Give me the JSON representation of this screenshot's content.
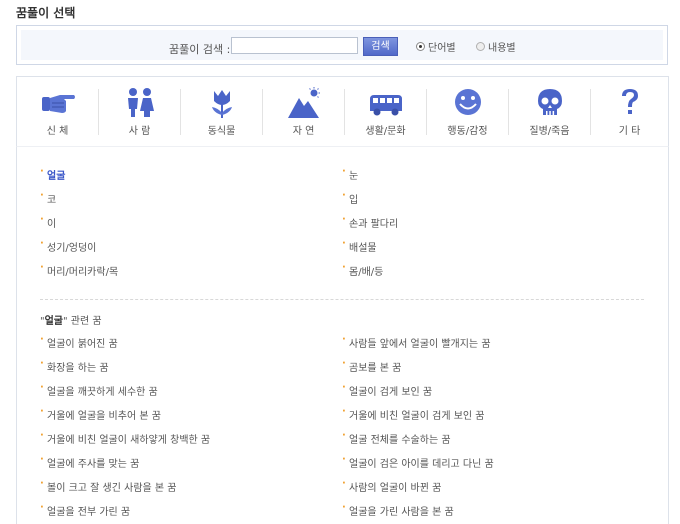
{
  "page_title": "꿈풀이 선택",
  "search": {
    "label": "꿈풀이 검색 :",
    "value": "",
    "placeholder": "",
    "button": "검색",
    "options": [
      {
        "label": "단어별",
        "selected": true
      },
      {
        "label": "내용별",
        "selected": false
      }
    ]
  },
  "categories": [
    {
      "label": "신 체",
      "icon": "pointing-hand-icon"
    },
    {
      "label": "사 람",
      "icon": "people-icon"
    },
    {
      "label": "동식물",
      "icon": "tulip-icon"
    },
    {
      "label": "자 연",
      "icon": "mountain-sun-icon"
    },
    {
      "label": "생활/문화",
      "icon": "bus-icon"
    },
    {
      "label": "행동/감정",
      "icon": "smiley-icon"
    },
    {
      "label": "질병/죽음",
      "icon": "skull-icon"
    },
    {
      "label": "기 타",
      "icon": "question-icon"
    }
  ],
  "body_parts": [
    "얼굴",
    "눈",
    "코",
    "입",
    "이",
    "손과 팔다리",
    "성기/엉덩이",
    "배설물",
    "머리/머리카락/목",
    "몸/배/등"
  ],
  "selected_part": "얼굴",
  "related": {
    "keyword": "얼굴",
    "title_suffix": "관련 꿈",
    "items": [
      "얼굴이 붉어진 꿈",
      "사람들 앞에서 얼굴이 빨개지는 꿈",
      "화장을 하는 꿈",
      "곰보를 본 꿈",
      "얼굴을 깨끗하게 세수한 꿈",
      "얼굴이 검게 보인 꿈",
      "거울에 얼굴을 비추어 본 꿈",
      "거울에 비친 얼굴이 검게 보인 꿈",
      "거울에 비친 얼굴이 새하얗게 창백한 꿈",
      "얼굴 전체를 수술하는 꿈",
      "얼굴에 주사를 맞는 꿈",
      "얼굴이 검은 아이를 데리고 다닌 꿈",
      "볼이 크고 잘 생긴 사람을 본 꿈",
      "사람의 얼굴이 바뀐 꿈",
      "얼굴을 전부 가린 꿈",
      "얼굴을 가린 사람을 본 꿈"
    ]
  },
  "colors": {
    "icon_blue": "#4a64c8",
    "accent": "#3a56c8",
    "bullet": "#f0a030"
  }
}
